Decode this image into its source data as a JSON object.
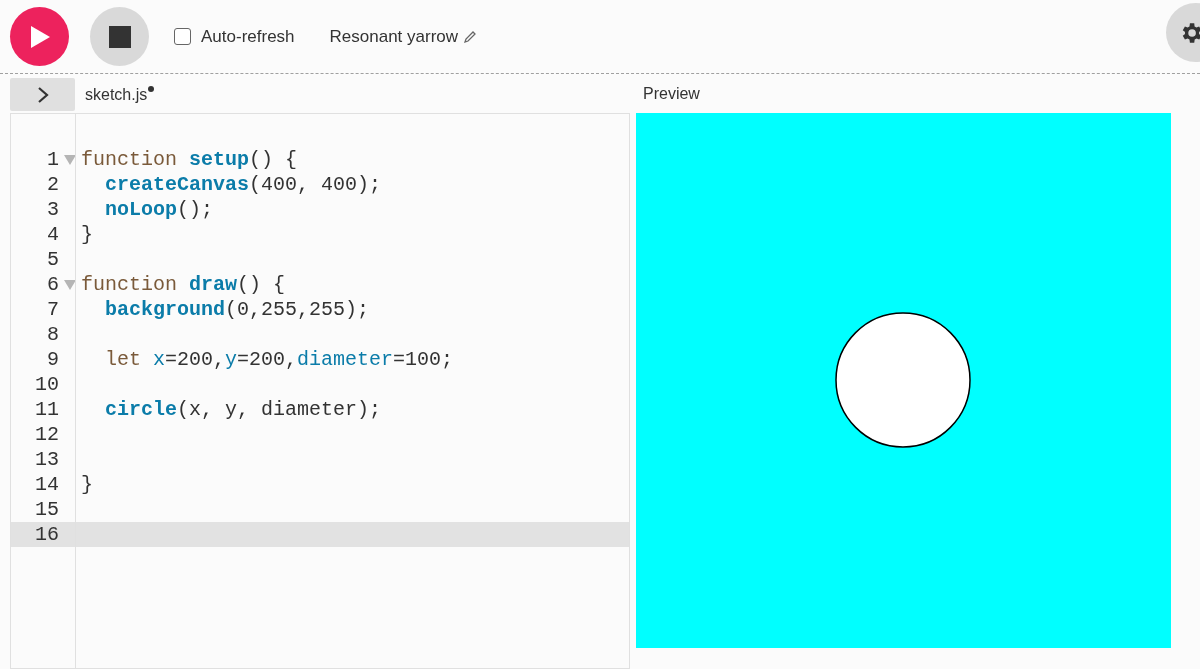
{
  "toolbar": {
    "auto_refresh": {
      "label": "Auto-refresh",
      "checked": false
    },
    "sketch_name": "Resonant yarrow"
  },
  "editor": {
    "tab": {
      "label": "sketch.js",
      "unsaved": true
    },
    "lines": [
      {
        "number": "1",
        "foldable": true,
        "active": false,
        "tokens": [
          {
            "text": "function",
            "kind": "keyword"
          },
          {
            "text": " setup",
            "kind": "def"
          },
          {
            "text": "() {",
            "kind": "plain"
          }
        ]
      },
      {
        "number": "2",
        "foldable": false,
        "active": false,
        "tokens": [
          {
            "text": "  createCanvas",
            "kind": "builtin"
          },
          {
            "text": "(400, 400);",
            "kind": "plain"
          }
        ]
      },
      {
        "number": "3",
        "foldable": false,
        "active": false,
        "tokens": [
          {
            "text": "  noLoop",
            "kind": "builtin"
          },
          {
            "text": "();",
            "kind": "plain"
          }
        ]
      },
      {
        "number": "4",
        "foldable": false,
        "active": false,
        "tokens": [
          {
            "text": "}",
            "kind": "plain"
          }
        ]
      },
      {
        "number": "5",
        "foldable": false,
        "active": false
      },
      {
        "number": "6",
        "foldable": true,
        "active": false,
        "tokens": [
          {
            "text": "function",
            "kind": "keyword"
          },
          {
            "text": " draw",
            "kind": "def"
          },
          {
            "text": "() {",
            "kind": "plain"
          }
        ]
      },
      {
        "number": "7",
        "foldable": false,
        "active": false,
        "tokens": [
          {
            "text": "  background",
            "kind": "builtin"
          },
          {
            "text": "(0,255,255);",
            "kind": "plain"
          }
        ]
      },
      {
        "number": "8",
        "foldable": false,
        "active": false
      },
      {
        "number": "9",
        "foldable": false,
        "active": false,
        "tokens": [
          {
            "text": "  let",
            "kind": "keyword"
          },
          {
            "text": " x",
            "kind": "variable"
          },
          {
            "text": "=200,",
            "kind": "plain"
          },
          {
            "text": "y",
            "kind": "variable"
          },
          {
            "text": "=200,",
            "kind": "plain"
          },
          {
            "text": "diameter",
            "kind": "variable"
          },
          {
            "text": "=100;",
            "kind": "plain"
          }
        ]
      },
      {
        "number": "10",
        "foldable": false,
        "active": false
      },
      {
        "number": "11",
        "foldable": false,
        "active": false,
        "tokens": [
          {
            "text": "  circle",
            "kind": "builtin"
          },
          {
            "text": "(x, y, diameter);",
            "kind": "plain"
          }
        ]
      },
      {
        "number": "12",
        "foldable": false,
        "active": false
      },
      {
        "number": "13",
        "foldable": false,
        "active": false
      },
      {
        "number": "14",
        "foldable": false,
        "active": false,
        "tokens": [
          {
            "text": "}",
            "kind": "plain"
          }
        ]
      },
      {
        "number": "15",
        "foldable": false,
        "active": false
      },
      {
        "number": "16",
        "foldable": false,
        "active": true
      }
    ]
  },
  "preview": {
    "label": "Preview"
  }
}
